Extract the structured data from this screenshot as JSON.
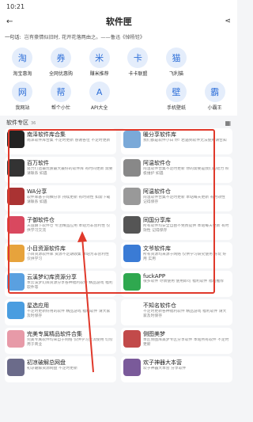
{
  "status": {
    "time": "10:21"
  },
  "header": {
    "title": "软件匣"
  },
  "notice": {
    "label": "一句话:",
    "text": "岂有豪情似旧时, 花开花落两由之。——鲁迅《悼杨铨》"
  },
  "icons": [
    {
      "label": "淘宝惠淘",
      "icon": "cart-icon",
      "glyph": "淘"
    },
    {
      "label": "全网优惠购",
      "icon": "coupon-icon",
      "glyph": "券"
    },
    {
      "label": "赚米推荐",
      "icon": "coin-icon",
      "glyph": "米"
    },
    {
      "label": "卡卡联盟",
      "icon": "card-icon",
      "glyph": "卡"
    },
    {
      "label": "飞利猫",
      "icon": "cat-icon",
      "glyph": "猫"
    },
    {
      "label": "",
      "icon": "blank",
      "glyph": ""
    },
    {
      "label": "我网站",
      "icon": "web-icon",
      "glyph": "网"
    },
    {
      "label": "帮个小忙",
      "icon": "help-icon",
      "glyph": "帮"
    },
    {
      "label": "API大全",
      "icon": "api-icon",
      "glyph": "A"
    },
    {
      "label": "",
      "icon": "blank",
      "glyph": ""
    },
    {
      "label": "手机壁纸",
      "icon": "wallpaper-icon",
      "glyph": "壁"
    },
    {
      "label": "小霸王",
      "icon": "game-icon",
      "glyph": "霸"
    }
  ],
  "section": {
    "title": "软件专区",
    "count": "36"
  },
  "cards": [
    {
      "name": "南泽软件库合集",
      "desc": "南泽软件库合集 不定时更新 感谢各位 不定时更新",
      "color": "#222"
    },
    {
      "name": "暖分享软件库",
      "desc": "我们都是软件小白 你! 若遇到软件无法使用请告知",
      "color": "#7aa9d8"
    },
    {
      "name": "百万软件",
      "desc": "努力打造最优质最大最好的软件库 有时间更新 需要请联系 如遇",
      "color": "#333"
    },
    {
      "name": "阿温软件仓",
      "desc": "阿温软件合集不定时更新 你的需要是我们的动力 积极维护 如遇",
      "color": "#888"
    },
    {
      "name": "WA分享",
      "desc": "软件库基于阿柚分享 持续更新 有时效性 如需下载请联系 如遇",
      "color": "#a33"
    },
    {
      "name": "阿温软件仓",
      "desc": "阿温软件合集不定时更新 本站每天更新 有时效性 记得保存",
      "color": "#999"
    },
    {
      "name": "子御软件仓",
      "desc": "天道酬下软件仓 专注精品应用 本站为非营利性 仅供学习交流",
      "color": "#d9485f"
    },
    {
      "name": "同国分享库",
      "desc": "所有软件均安全自由不免费提供 本站每天更新 有时效性 记得保存",
      "color": "#555"
    },
    {
      "name": "小目资源软件库",
      "desc": "小目资源软件库 资源不定期收集 本站为非营利性 仅供学习",
      "color": "#e7a33c"
    },
    {
      "name": "文爷软件库",
      "desc": "所有资源均来源于网络 仅供学习研究使用 好玩 好用 实用",
      "color": "#3a7bd5"
    },
    {
      "name": "云溪梦幻库资源分享",
      "desc": "本云溪梦幻库资源分享各种福利软件 精品游戏 福利软件等",
      "color": "#5aa0e0"
    },
    {
      "name": "fuckAPP",
      "desc": "很多软件 尽情使用 使用即可 福利软件 福利推荐",
      "color": "#2fa84f"
    },
    {
      "name": "星选应用",
      "desc": "不定时更新好用的软件 精品游戏 福利软件 请大家及时保存",
      "color": "#4a9de0"
    },
    {
      "name": "不知名软件仓",
      "desc": "不定时更新各种福利软件 精品游戏 福利软件 请大家及时保存",
      "color": "#fff"
    },
    {
      "name": "完美专属精品软件合集",
      "desc": "完美专属软件均来自于网络 仅供学习交流使用 切勿用于商业",
      "color": "#e79aa8"
    },
    {
      "name": "侧图美梦",
      "desc": "本区侧图库美梦专区分享软件 本站所有软件 不定时更新",
      "color": "#c24a4a"
    },
    {
      "name": "初凉破解总网盘",
      "desc": "初凉破解资源网盘 不定时更新",
      "color": "#6b6b8a"
    },
    {
      "name": "欢子神器大本营",
      "desc": "欢子神器大本营 分享软件",
      "color": "#7a5a9a"
    }
  ]
}
